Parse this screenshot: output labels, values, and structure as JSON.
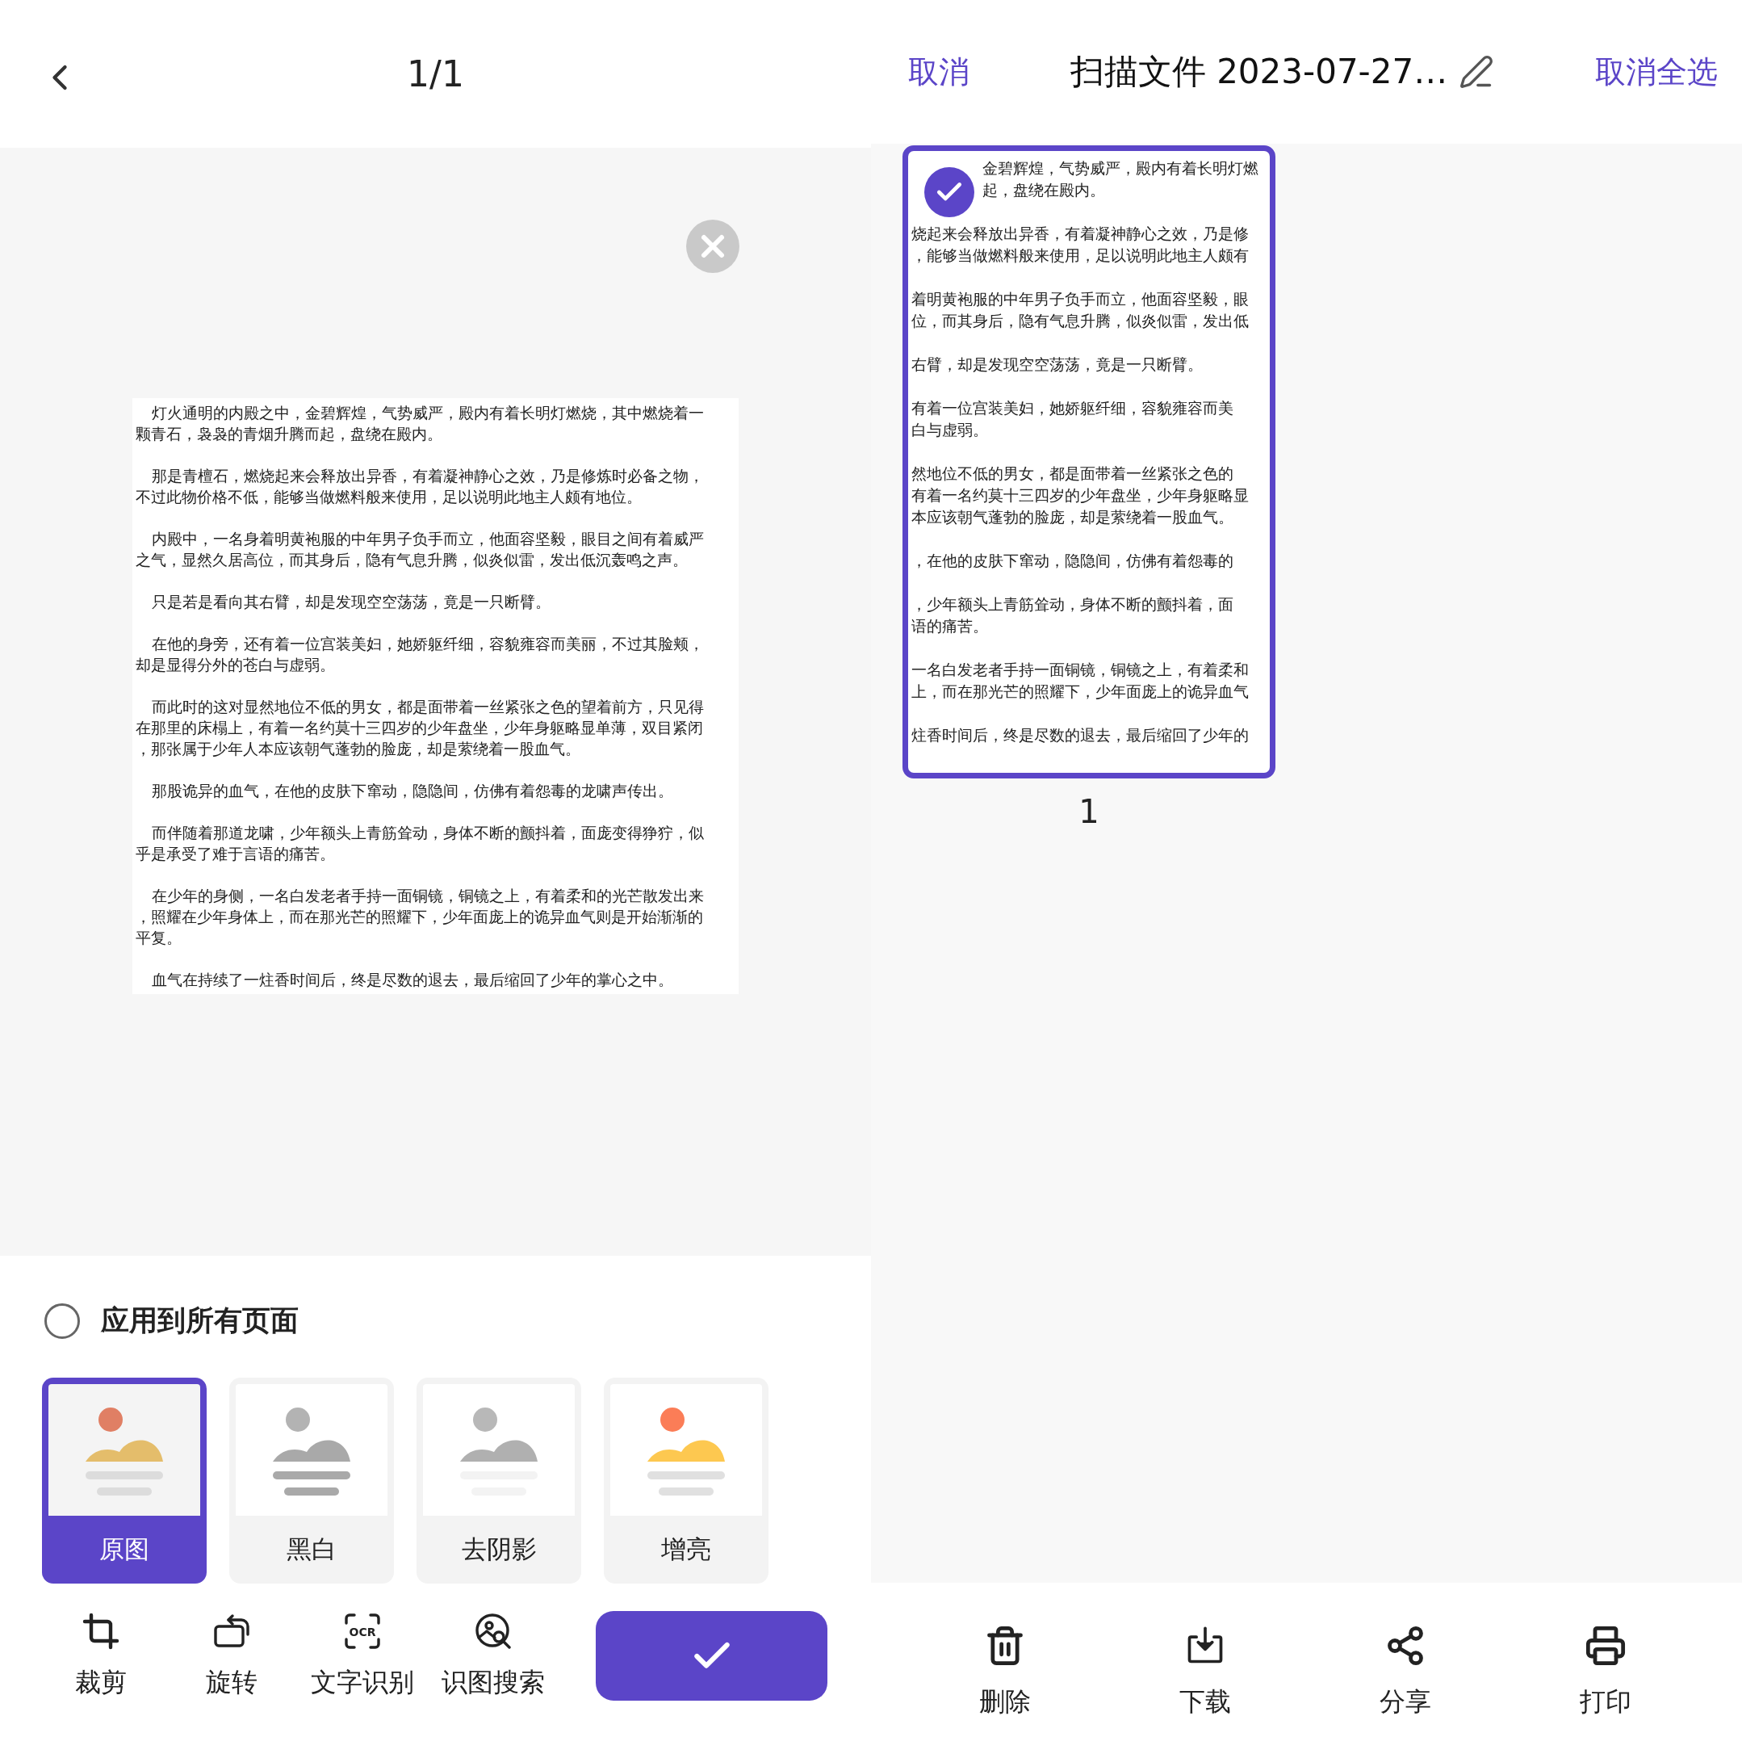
{
  "left": {
    "header": {
      "title": "1/1"
    },
    "document": {
      "paragraphs": [
        [
          "灯火通明的内殿之中，金碧辉煌，气势威严，殿内有着长明灯燃烧，其中燃烧着一",
          "颗青石，袅袅的青烟升腾而起，盘绕在殿内。"
        ],
        [
          "那是青檀石，燃烧起来会释放出异香，有着凝神静心之效，乃是修炼时必备之物，",
          "不过此物价格不低，能够当做燃料般来使用，足以说明此地主人颇有地位。"
        ],
        [
          "内殿中，一名身着明黄袍服的中年男子负手而立，他面容坚毅，眼目之间有着威严",
          "之气，显然久居高位，而其身后，隐有气息升腾，似炎似雷，发出低沉轰鸣之声。"
        ],
        [
          "只是若是看向其右臂，却是发现空空荡荡，竟是一只断臂。"
        ],
        [
          "在他的身旁，还有着一位宫装美妇，她娇躯纤细，容貌雍容而美丽，不过其脸颊，",
          "却是显得分外的苍白与虚弱。"
        ],
        [
          "而此时的这对显然地位不低的男女，都是面带着一丝紧张之色的望着前方，只见得",
          "在那里的床榻上，有着一名约莫十三四岁的少年盘坐，少年身躯略显单薄，双目紧闭",
          "，那张属于少年人本应该朝气蓬勃的脸庞，却是萦绕着一股血气。"
        ],
        [
          "那股诡异的血气，在他的皮肤下窜动，隐隐间，仿佛有着怨毒的龙啸声传出。"
        ],
        [
          "而伴随着那道龙啸，少年额头上青筋耸动，身体不断的颤抖着，面庞变得狰狞，似",
          "乎是承受了难于言语的痛苦。"
        ],
        [
          "在少年的身侧，一名白发老者手持一面铜镜，铜镜之上，有着柔和的光芒散发出来",
          "，照耀在少年身体上，而在那光芒的照耀下，少年面庞上的诡异血气则是开始渐渐的",
          "平复。"
        ],
        [
          "血气在持续了一炷香时间后，终是尽数的退去，最后缩回了少年的掌心之中。"
        ]
      ]
    },
    "apply_all": {
      "label": "应用到所有页面",
      "checked": false
    },
    "filters": [
      {
        "label": "原图",
        "kind": "original",
        "selected": true
      },
      {
        "label": "黑白",
        "kind": "mono",
        "selected": false
      },
      {
        "label": "去阴影",
        "kind": "shadow",
        "selected": false
      },
      {
        "label": "增亮",
        "kind": "bright",
        "selected": false
      }
    ],
    "tools": [
      {
        "label": "裁剪",
        "kind": "crop"
      },
      {
        "label": "旋转",
        "kind": "rotate"
      },
      {
        "label": "文字识别",
        "kind": "ocr",
        "icon_text": "OCR"
      },
      {
        "label": "识图搜索",
        "kind": "image-search"
      }
    ]
  },
  "right": {
    "header": {
      "cancel": "取消",
      "title": "扫描文件 2023-07-27…",
      "select_toggle": "取消全选"
    },
    "pages": [
      {
        "number": "1",
        "selected": true,
        "paragraphs": [
          [
            "金碧辉煌，气势威严，殿内有着长明灯燃",
            "起，盘绕在殿内。"
          ],
          [
            "烧起来会释放出异香，有着凝神静心之效，乃是修",
            "，能够当做燃料般来使用，足以说明此地主人颇有"
          ],
          [
            "着明黄袍服的中年男子负手而立，他面容坚毅，眼",
            "位，而其身后，隐有气息升腾，似炎似雷，发出低"
          ],
          [
            "右臂，却是发现空空荡荡，竟是一只断臂。"
          ],
          [
            "有着一位宫装美妇，她娇躯纤细，容貌雍容而美",
            "白与虚弱。"
          ],
          [
            "然地位不低的男女，都是面带着一丝紧张之色的",
            "有着一名约莫十三四岁的少年盘坐，少年身躯略显",
            "本应该朝气蓬勃的脸庞，却是萦绕着一股血气。"
          ],
          [
            "，在他的皮肤下窜动，隐隐间，仿佛有着怨毒的"
          ],
          [
            "，少年额头上青筋耸动，身体不断的颤抖着，面",
            "语的痛苦。"
          ],
          [
            "一名白发老者手持一面铜镜，铜镜之上，有着柔和",
            "上，而在那光芒的照耀下，少年面庞上的诡异血气"
          ],
          [
            "炷香时间后，终是尽数的退去，最后缩回了少年的"
          ]
        ]
      }
    ],
    "actions": [
      {
        "label": "删除",
        "kind": "delete"
      },
      {
        "label": "下载",
        "kind": "download"
      },
      {
        "label": "分享",
        "kind": "share"
      },
      {
        "label": "打印",
        "kind": "print"
      }
    ]
  }
}
